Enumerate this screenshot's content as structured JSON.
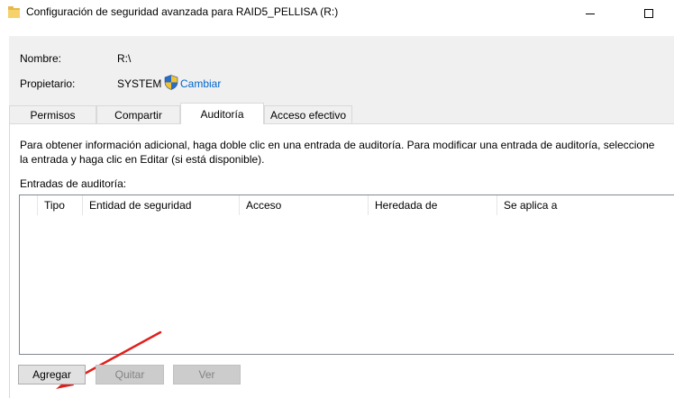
{
  "window": {
    "title": "Configuración de seguridad avanzada para RAID5_PELLISA (R:)",
    "controls": [
      "minimize",
      "maximize"
    ]
  },
  "info": {
    "name_label": "Nombre:",
    "name_value": "R:\\",
    "owner_label": "Propietario:",
    "owner_value": "SYSTEM",
    "change_link": "Cambiar"
  },
  "tabs": [
    {
      "label": "Permisos",
      "selected": false
    },
    {
      "label": "Compartir",
      "selected": false
    },
    {
      "label": "Auditoría",
      "selected": true
    },
    {
      "label": "Acceso efectivo",
      "selected": false
    }
  ],
  "audit": {
    "description": "Para obtener información adicional, haga doble clic en una entrada de auditoría. Para modificar una entrada de auditoría, seleccione la entrada y haga clic en Editar (si está disponible).",
    "entries_label": "Entradas de auditoría:",
    "columns": [
      "Tipo",
      "Entidad de seguridad",
      "Acceso",
      "Heredada de",
      "Se aplica a"
    ],
    "rows": []
  },
  "buttons": {
    "add": "Agregar",
    "remove": "Quitar",
    "view": "Ver"
  },
  "colors": {
    "link": "#0066cc",
    "annotation_arrow": "#e0201c",
    "window_bg": "#f0f0f0"
  },
  "icons": {
    "title": "folder-icon",
    "owner_change": "uac-shield-icon"
  }
}
